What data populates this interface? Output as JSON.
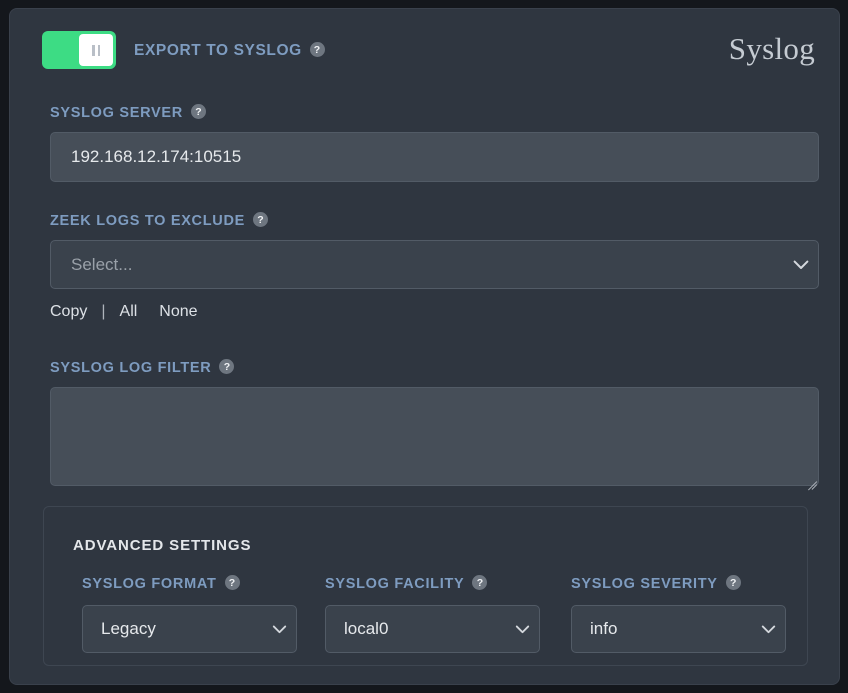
{
  "app": {
    "title": "Syslog"
  },
  "header": {
    "toggle": {
      "label": "EXPORT TO SYSLOG",
      "state": "on",
      "knob_icon": "pause-icon",
      "on_color": "#3ddc84"
    },
    "help_icon": "?"
  },
  "fields": {
    "syslog_server": {
      "label": "SYSLOG SERVER",
      "value": "192.168.12.174:10515",
      "placeholder": ""
    },
    "zeek_logs_to_exclude": {
      "label": "ZEEK LOGS TO EXCLUDE",
      "placeholder": "Select...",
      "value": "",
      "chevron_icon": "chevron-down-icon"
    },
    "syslog_log_filter": {
      "label": "SYSLOG LOG FILTER",
      "value": "",
      "placeholder": ""
    }
  },
  "links": {
    "copy": "Copy",
    "separator": "|",
    "all": "All",
    "none": "None"
  },
  "advanced": {
    "title": "ADVANCED SETTINGS",
    "columns": [
      {
        "key": "syslog_format",
        "label": "SYSLOG FORMAT",
        "value": "Legacy",
        "chevron_icon": "chevron-down-icon"
      },
      {
        "key": "syslog_facility",
        "label": "SYSLOG FACILITY",
        "value": "local0",
        "chevron_icon": "chevron-down-icon"
      },
      {
        "key": "syslog_severity",
        "label": "SYSLOG SEVERITY",
        "value": "info",
        "chevron_icon": "chevron-down-icon"
      }
    ]
  },
  "colors": {
    "page_background": "#14171c",
    "panel_background": "#2f3640",
    "label_accent": "#7e9cc0",
    "input_background": "#464e58",
    "select_background": "#3a424c",
    "toggle_on": "#3ddc84"
  }
}
